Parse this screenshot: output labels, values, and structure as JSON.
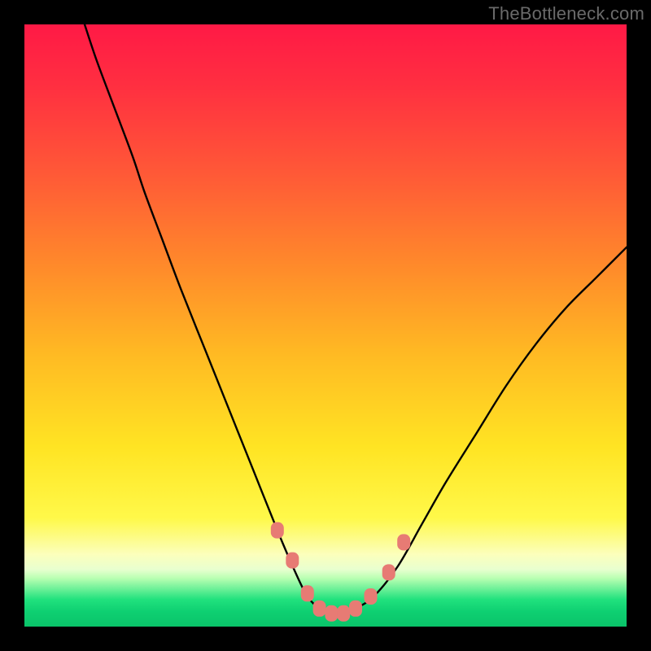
{
  "watermark": "TheBottleneck.com",
  "chart_data": {
    "type": "line",
    "title": "",
    "xlabel": "",
    "ylabel": "",
    "xlim": [
      0,
      100
    ],
    "ylim": [
      0,
      100
    ],
    "grid": false,
    "legend": false,
    "series": [
      {
        "name": "bottleneck-curve",
        "x": [
          10,
          12,
          15,
          18,
          20,
          23,
          26,
          30,
          34,
          38,
          42,
          45,
          47,
          49,
          51,
          53,
          55,
          58,
          62,
          66,
          70,
          75,
          80,
          85,
          90,
          95,
          100
        ],
        "y": [
          100,
          94,
          86,
          78,
          72,
          64,
          56,
          46,
          36,
          26,
          16,
          9,
          5,
          3,
          2,
          2,
          3,
          5,
          10,
          17,
          24,
          32,
          40,
          47,
          53,
          58,
          63
        ]
      }
    ],
    "markers": {
      "name": "curve-dots",
      "x": [
        42,
        44.5,
        47,
        49,
        51,
        53,
        55,
        57.5,
        60.5,
        63
      ],
      "y": [
        16,
        11,
        5.5,
        3,
        2.2,
        2.2,
        3,
        5,
        9,
        14
      ],
      "color": "#e77b74",
      "radius": 8
    },
    "background_gradient": {
      "stops": [
        {
          "pos": 0.0,
          "color": "#ff1a46"
        },
        {
          "pos": 0.1,
          "color": "#ff2f41"
        },
        {
          "pos": 0.25,
          "color": "#ff5a37"
        },
        {
          "pos": 0.4,
          "color": "#ff8a2b"
        },
        {
          "pos": 0.55,
          "color": "#ffbb23"
        },
        {
          "pos": 0.7,
          "color": "#ffe423"
        },
        {
          "pos": 0.82,
          "color": "#fff94a"
        },
        {
          "pos": 0.88,
          "color": "#fcffbc"
        },
        {
          "pos": 0.905,
          "color": "#e9ffd0"
        },
        {
          "pos": 0.92,
          "color": "#b8ffb2"
        },
        {
          "pos": 0.955,
          "color": "#21e27e"
        },
        {
          "pos": 0.975,
          "color": "#0fd072"
        },
        {
          "pos": 1.0,
          "color": "#0ac46a"
        }
      ]
    }
  }
}
